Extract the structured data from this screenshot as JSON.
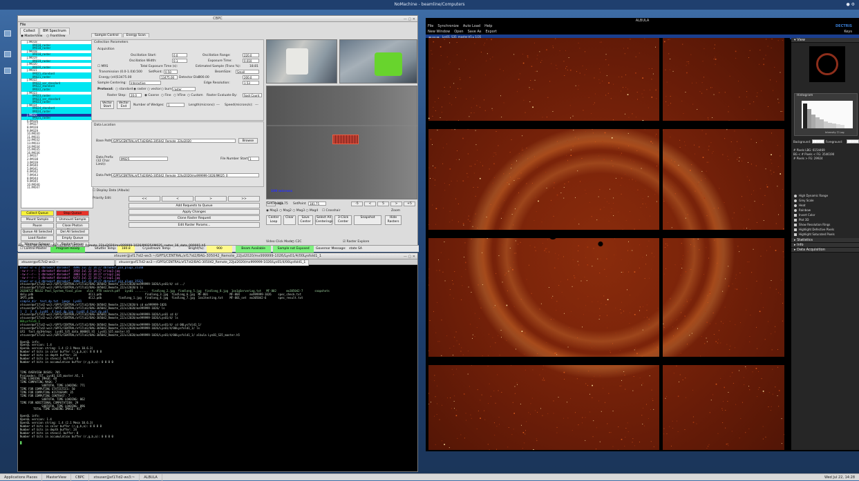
{
  "topbar": {
    "title": "NoMachine - beamline/Computers",
    "right": "● ⚙"
  },
  "control_window": {
    "title": "CBPC",
    "menu": "File",
    "top_tabs": [
      "Collect",
      "BM Spectrum"
    ],
    "view_options": [
      "MasterView",
      "FrontView"
    ],
    "right_tabs": [
      "Sample Control",
      "Energy Scan"
    ],
    "tree_items": [
      {
        "label": "J.IM018",
        "style": "plain"
      },
      {
        "label": "IM018_raster",
        "style": "cyan"
      },
      {
        "label": "IM018_raster",
        "style": "cyan"
      },
      {
        "label": "J.IM018",
        "style": "plain"
      },
      {
        "label": "IM018_raster",
        "style": "cyan"
      },
      {
        "label": "J.IM019",
        "style": "plain"
      },
      {
        "label": "IM019_raster",
        "style": "cyan"
      },
      {
        "label": "J.IM020",
        "style": "plain"
      },
      {
        "label": "IM020_raster",
        "style": "cyan"
      },
      {
        "label": "J.IM021",
        "style": "plain"
      },
      {
        "label": "IM021_standard",
        "style": "cyan"
      },
      {
        "label": "IM021_raster",
        "style": "cyan"
      },
      {
        "label": "J.IM022",
        "style": "plain"
      },
      {
        "label": "IM022_ser_standard",
        "style": "cyan"
      },
      {
        "label": "IM022_standard",
        "style": "cyan"
      },
      {
        "label": "IM022_raster",
        "style": "cyan"
      },
      {
        "label": "J.IM023",
        "style": "plain"
      },
      {
        "label": "IM023_raster",
        "style": "cyan"
      },
      {
        "label": "IM023_ser_standard",
        "style": "cyan"
      },
      {
        "label": "IM023_raster",
        "style": "cyan"
      },
      {
        "label": "J.IM024",
        "style": "plain"
      },
      {
        "label": "IM024_standard",
        "style": "cyan"
      },
      {
        "label": "IM024_raster",
        "style": "cyan"
      },
      {
        "label": "J.IM025",
        "style": "selected"
      },
      {
        "label": "IM025_raster",
        "style": "cyan"
      },
      {
        "label": "6.IM026",
        "style": "plain"
      },
      {
        "label": "7.IM027",
        "style": "plain"
      },
      {
        "label": "8.IM028",
        "style": "plain"
      },
      {
        "label": "9.IM029",
        "style": "plain"
      },
      {
        "label": "10.IM030",
        "style": "plain"
      },
      {
        "label": "11.IM031",
        "style": "plain"
      },
      {
        "label": "12.IM032",
        "style": "plain"
      },
      {
        "label": "13.IM033",
        "style": "plain"
      },
      {
        "label": "14.IM034",
        "style": "plain"
      },
      {
        "label": "15.IM035",
        "style": "plain"
      },
      {
        "label": "16.IM036",
        "style": "plain"
      },
      {
        "label": "1.IM037",
        "style": "plain"
      },
      {
        "label": "2.IM038",
        "style": "plain"
      },
      {
        "label": "3.IM039",
        "style": "plain"
      },
      {
        "label": "4.IM040",
        "style": "plain"
      },
      {
        "label": "5.IM041",
        "style": "plain"
      },
      {
        "label": "6.IM042",
        "style": "plain"
      },
      {
        "label": "7.IM043",
        "style": "plain"
      },
      {
        "label": "8.IM044",
        "style": "plain"
      },
      {
        "label": "9.IM045",
        "style": "plain"
      },
      {
        "label": "10.IM046",
        "style": "plain"
      },
      {
        "label": "11.IM047",
        "style": "plain"
      }
    ],
    "left_buttons": [
      [
        "Collect Queue",
        "Stop Queue"
      ],
      [
        "Mount Sample",
        "Unmount Sample"
      ],
      [
        "Pause",
        "Close Photon Shutter"
      ],
      [
        "Queue All Selected",
        "Del All Selected"
      ],
      [
        "Load Raster",
        "Empty Queue"
      ],
      [
        "Warmup Gripper",
        "Restart Server"
      ]
    ],
    "params": {
      "section": "Collection Parameters",
      "acquisition": "Acquisition",
      "osc_start_label": "Oscillation Start:",
      "osc_start": "0.0",
      "osc_range_label": "Oscillation Range:",
      "osc_range": "220.0",
      "osc_width_label": "Oscillation Width:",
      "osc_width": "0.1",
      "exposure_label": "Exposure Time:",
      "exposure": "0.010",
      "mrs_label": "MRS",
      "total_exp_label": "Total Exposure Time (s):",
      "est_sample_label": "Estimated Sample (Trans %):",
      "est_sample": "18.81",
      "transmission_label": "Transmission (0.0-1.0):",
      "transmission": "0.500",
      "setpoint_label": "SetPoint:",
      "setpoint": "0.50",
      "beamsize_label": "BeamSize:",
      "beamsize": "Small",
      "energy_label": "Energy (eV):",
      "energy": "13475.00",
      "det_dist_label": "Detector Dist:",
      "det_dist": "200.00",
      "setpoint2": "200.0",
      "sample_centering_label": "Sample Centering:",
      "sample_centering": "Interactive",
      "edge_res_label": "Edge Resolution:",
      "edge_res": "1.53",
      "protocol_label": "Protocol:",
      "protocols": [
        "standard",
        "raster",
        "vector",
        "burn"
      ],
      "protocol_sel": "raster",
      "raster_step_label": "Raster Step:",
      "raster_step": "20.0",
      "raster_opts": [
        "Coarse",
        "Fine",
        "VFine",
        "Custom"
      ],
      "raster_eval_label": "Raster Evaluate By:",
      "raster_eval": "Spot Count",
      "vector_start": "Vector Start",
      "vector_end": "Vector End",
      "num_wedges_label": "Number of Wedges:",
      "num_wedges": "1",
      "length_label": "Length(microns):",
      "length": "---",
      "speed_label": "Speed(microns/s):",
      "speed": "---"
    },
    "data_location": {
      "section": "Data Location",
      "base_path_label": "Base Path:",
      "base_path": "/GPFS/CENTRAL/xf17id2/BAG-305042_Remote_22Jul2020",
      "browse": "Browse",
      "prefix_label": "Data Prefix (32 Char Limit):",
      "prefix": "IM025",
      "file_start_label": "File Number Start:",
      "file_start": "1",
      "data_path_label": "Data Path:",
      "data_path": "/GPFS/CENTRAL/xf17id2/BAG-305042_Remote_22Jul2020/mx999999-1026/IM025_0",
      "display_data": "Display Data (Albula)"
    },
    "priority_label": "Priority Edit:",
    "priority_btns": [
      "<<",
      "<",
      ">",
      ">>"
    ],
    "action_btns": [
      "Add Requests to Queue",
      "Apply Changes",
      "Clone Raster Request",
      "Edit Raster Params..."
    ],
    "camera": {
      "omega_label": "SetOmega",
      "omega_val": "181.75",
      "setpoint_label": "SetPoint",
      "setpoint_val": "181.75",
      "step_btns": [
        "-5",
        "<",
        "5",
        ">",
        "+5"
      ],
      "mag_opts": [
        "Mag1",
        "Mag2",
        "Mag3",
        "Mag4"
      ],
      "crosshair": "Crosshair",
      "zoom_label": "Zoom",
      "bot_btns": [
        "Center Loop",
        "Clear",
        "Save Center",
        "Select All Centerings",
        "3-Click Center",
        "Snapshot",
        "Hide Rasters"
      ],
      "click_mode_label": "Video Click Mode:",
      "click_mode": "C2C",
      "raster_explore": "Raster Explore",
      "overlay_text": "100 microns"
    },
    "status": {
      "control_master": "Control Master",
      "program_ready": "Program Ready",
      "shutter_temp_label": "Shutter Temp:",
      "shutter_temp": "180.8",
      "cryostream_label": "Cryostream Temp:",
      "bright_label": "Bright(%):",
      "bright": "900",
      "beam_available": "Beam Available",
      "sample_exposed": "Sample not Exposed",
      "governor_label": "Governor Message:",
      "governor": "state SA"
    },
    "file_line": "File: /GPFS/CENTRAL/xf17id2/BAG-305042_Remote_22Jul2020/mx999999-1026/IM025/IM025_raster_16_data_000001.h5"
  },
  "terminal": {
    "title": "xtsuser@xf17id2-ws3:~/GPFS/CENTRAL/xf17id2/BAG-305042_Remote_22Jul2020/mx999999-1026/Lys01/4/00Lysfold1_1",
    "tabs": [
      "xtsuser@xf17id2-ws3:~",
      "xtsuser@xf17id2-ws3:~/GPFS/CENTRAL/xf17id2/BAG-305042_Remote_22Jul2020/mx999999-1026/Lys01/4/00Lysfold1_1"
    ],
    "lines": [
      {
        "t": "drwxr-xr-x 2 dbrooksf dbrooksf  4096 Jul 22 14:27 dbrooksf_pin_plugs_35140",
        "c": "#6fa8ff"
      },
      {
        "t": "-rw-r--r-- 1 dbrooksf dbrooksf  1934 Jul 22 14:27 crisp3.jpg",
        "c": "#e879e8"
      },
      {
        "t": "-rw-r--r-- 1 dbrooksf dbrooksf  3883 Jul 22 14:27 crisp2.jpg",
        "c": "#e879e8"
      },
      {
        "t": "-rw-r--r-- 1 dbrooksf dbrooksf  6473 Jul 22 14:27 crisp1.jpg",
        "c": "#e879e8"
      },
      {
        "t": "drwxr-xr-x 2 dbrooksf dbrooksf  4096 Jul 22 14:27 dbrooksf_pin_plugs_35321",
        "c": "#6fa8ff"
      },
      {
        "t": "xtsuser@xf17id2-ws3:/GPFS/CENTRAL/xf17id2/BAG-305042_Remote_22Jul2020/mx999999-1026/Lys01/4/ cd ../",
        "c": "#cfd8cf"
      },
      {
        "t": "xtsuser@xf17id2-ws3:/GPFS/CENTRAL/xf17id2/BAG-305042_Remote_22Jul2020/$ ls",
        "c": "#cfd8cf"
      },
      {
        "t": "20200722 NSLS2 Pool_System_final_plan   xlsx  PTR search.pdf   Lys01 ........  findlong_2.jpg  findlong_5.jpg  findlong_8.jpg  1oo1gServerLog.txt   MF-802      mx305042-7       snapshots",
        "c": "#9fd39f"
      },
      {
        "t": "4mly.pdb                                 4Ci1.pdb                          findlong_3.jpg  findlong_6.jpg  MF-801             MF-804      mx999999-1026    spec_check.txt",
        "c": "#cfd8cf"
      },
      {
        "t": "3M75.pdb                                 4Ci2.pdb          findlong_1.jpg  findlong_4.jpg  findlong_7.jpg  1oo1testing.txt    MF-801_set  mx305042-6       spec_result.txt",
        "c": "#cfd8cf"
      },
      {
        "t": "simple_dir  test_dp.txt  jpegs  Lys01",
        "c": "#6fa8ff"
      },
      {
        "t": "xtsuser@xf17id2-ws3:/GPFS/CENTRAL/xf17id2/BAG-305042_Remote_22Jul2020/$ cd mx999999-1026",
        "c": "#cfd8cf"
      },
      {
        "t": "xtsuser@xf17id2-ws3:/GPFS/CENTRAL/xf17id2/BAG-305042_Remote_22Jul2020/mx999999-1026/ ls",
        "c": "#cfd8cf"
      },
      {
        "t": "1  2  3  4  Lys01  4_test_dp.log  Lys01_4_fast_dp.pkl",
        "c": "#6fa8ff"
      },
      {
        "t": "xtsuser@xf17id2-ws3:/GPFS/CENTRAL/xf17id2/BAG-305042_Remote_22Jul2020/mx999999-1026/Lys01 cd 4/",
        "c": "#cfd8cf"
      },
      {
        "t": "xtsuser@xf17id2-ws3:/GPFS/CENTRAL/xf17id2/BAG-305042_Remote_22Jul2020/mx999999-1026/Lys01/4/ ls",
        "c": "#cfd8cf"
      },
      {
        "t": "00Lysfold1_1",
        "c": "#60d060"
      },
      {
        "t": "xtsuser@xf17id2-ws3:/GPFS/CENTRAL/xf17id2/BAG-305042_Remote_22Jul2020/mx999999-1026/Lys01/4/ cd 00Lysfold1_1/",
        "c": "#cfd8cf"
      },
      {
        "t": "xtsuser@xf17id2-ws3:/GPFS/CENTRAL/xf17id2/BAG-305042_Remote_22Jul2020/mx999999-1026/Lys01/4/00Lysfold1_1/ ls",
        "c": "#cfd8cf"
      },
      {
        "t": "LR1  fast_dp1Hoteps  Lys01_S35_data_000001.h5  Lys01_S35_master.h5",
        "c": "#cfd8cf"
      },
      {
        "t": "xtsuser@xf17id2-ws3:/GPFS/CENTRAL/xf17id2/BAG-305042_Remote_22Jul2020/mx999999-1026/Lys01/4/00Lysfold1_1/ albula Lys01_S35_master.h5",
        "c": "#cfd8cf"
      },
      {
        "t": "",
        "c": "#cfd8cf"
      },
      {
        "t": "OpenGL info:",
        "c": "#cfd8cf"
      },
      {
        "t": "OpenGL version: 1.4",
        "c": "#cfd8cf"
      },
      {
        "t": "OpenGL version string: 1.4 (2.1 Mesa 10.6.3)",
        "c": "#cfd8cf"
      },
      {
        "t": "Number of bits in color buffer (r,g,b,a): 8 8 8 8",
        "c": "#cfd8cf"
      },
      {
        "t": "Number of bits in depth buffer: 24",
        "c": "#cfd8cf"
      },
      {
        "t": "Number of bits in stencil buffer: 8",
        "c": "#cfd8cf"
      },
      {
        "t": "Number of bits in accumulation buffer (r,g,b,a): 0 0 0 0",
        "c": "#cfd8cf"
      },
      {
        "t": "",
        "c": "#cfd8cf"
      },
      {
        "t": "",
        "c": "#cfd8cf"
      },
      {
        "t": "TIME OVERVIEW DUSOS: 705",
        "c": "#cfd8cf"
      },
      {
        "t": "Preloader: FST, Lys01_S35_master.h5, 1",
        "c": "#cfd8cf"
      },
      {
        "t": "TIME LOADING IMAGE: 48",
        "c": "#cfd8cf"
      },
      {
        "t": "TIME COMPUTING MASK: 7",
        "c": "#cfd8cf"
      },
      {
        "t": "             SUBTOTAL TIME LOADING: 771",
        "c": "#cfd8cf"
      },
      {
        "t": "TIME FOR COMPUTING STATISTICS: 50",
        "c": "#cfd8cf"
      },
      {
        "t": "TIME FOR COMPUTING HISTOGRAM: 35",
        "c": "#cfd8cf"
      },
      {
        "t": "TIME FOR COMPUTING CONTRAST: 7",
        "c": "#cfd8cf"
      },
      {
        "t": "             SUBTOTAL TIME LOADING: 862",
        "c": "#cfd8cf"
      },
      {
        "t": "TIME FOR ADDITIONAL COMPUTATION: 29",
        "c": "#cfd8cf"
      },
      {
        "t": "             SUBTOTAL TIME LOADING: 896",
        "c": "#cfd8cf"
      },
      {
        "t": "        TOTAL TIME LOADING IMAGE: 917",
        "c": "#cfd8cf"
      },
      {
        "t": "",
        "c": "#cfd8cf"
      },
      {
        "t": "OpenGL info:",
        "c": "#cfd8cf"
      },
      {
        "t": "OpenGL version: 1.4",
        "c": "#cfd8cf"
      },
      {
        "t": "OpenGL version string: 1.4 (2.1 Mesa 10.6.3)",
        "c": "#cfd8cf"
      },
      {
        "t": "Number of bits in color buffer (r,g,b,a): 8 8 8 8",
        "c": "#cfd8cf"
      },
      {
        "t": "Number of bits in depth buffer: 24",
        "c": "#cfd8cf"
      },
      {
        "t": "Number of bits in stencil buffer: 8",
        "c": "#cfd8cf"
      },
      {
        "t": "Number of bits in accumulation buffer (r,g,b,a): 0 0 0 0",
        "c": "#cfd8cf"
      },
      {
        "t": "",
        "c": "#cfd8cf"
      },
      {
        "t": "█",
        "c": "#60d060"
      }
    ]
  },
  "albula": {
    "title": "ALBULA",
    "menu": [
      "File",
      "Synchronize",
      "Auto Load",
      "Help"
    ],
    "menu2": [
      "New Window",
      "Open",
      "Save As",
      "Export"
    ],
    "keys": "Keys",
    "brand": "DECTRIS",
    "toolbar_file": "Lys01_S35_master.h5 ▸ 1/35",
    "sections": {
      "view": "View",
      "histogram": "Histogram",
      "intensity": "Intensity",
      "log": "Log",
      "background_label": "Background:",
      "background": "1.0000",
      "foreground_label": "Foreground:",
      "foreground": "9.0000",
      "stats": [
        "# Pixels LBG: 6154469",
        "BG < # Pixels < FG: 3546190",
        "# Pixels > FG: 29924"
      ],
      "options": [
        "High Dynamic Range",
        "Grey Scale",
        "Heat",
        "Rainbow",
        "Invert Color",
        "Plot 3D",
        "Show Resolution Rings",
        "Highlight Defective Pixels",
        "Highlight Saturated Pixels"
      ],
      "statistics": "Statistics",
      "info": "Info",
      "data_acq": "Data Acquisition"
    }
  },
  "taskbar": {
    "items": [
      "Applications Places",
      "MasterView",
      "CBPC",
      "xtsuser@xf17id2-ws3:~",
      "ALBULA"
    ],
    "clock": "Wed Jul 22, 14:28"
  }
}
